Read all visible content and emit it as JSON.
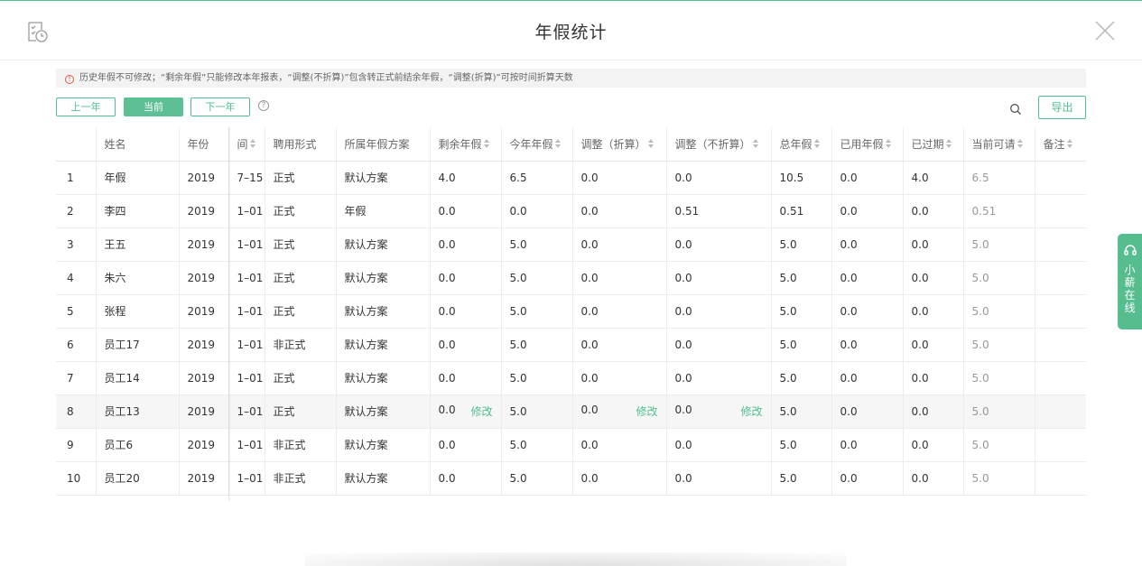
{
  "dialog": {
    "title": "年假统计"
  },
  "notice": "历史年假不可修改；“剩余年假”只能修改本年报表，“调整(不折算)”包含转正式前结余年假，“调整(折算)”可按时间折算天数",
  "toolbar": {
    "prev_year": "上一年",
    "current": "当前",
    "next_year": "下一年",
    "help": "?",
    "export": "导出"
  },
  "table": {
    "columns": [
      "",
      "姓名",
      "年份",
      "间",
      "聘用形式",
      "所属年假方案",
      "剩余年假",
      "今年年假",
      "调整（折算）",
      "调整（不折算）",
      "总年假",
      "已用年假",
      "已过期",
      "当前可请",
      "备注"
    ],
    "edit_label": "修改",
    "rows": [
      [
        "1",
        "年假",
        "2019",
        "7–15",
        "正式",
        "默认方案",
        "4.0",
        "6.5",
        "0.0",
        "0.0",
        "10.5",
        "0.0",
        "4.0",
        "6.5",
        ""
      ],
      [
        "2",
        "李四",
        "2019",
        "1–01",
        "正式",
        "年假",
        "0.0",
        "0.0",
        "0.0",
        "0.51",
        "0.51",
        "0.0",
        "0.0",
        "0.51",
        ""
      ],
      [
        "3",
        "王五",
        "2019",
        "1–01",
        "正式",
        "默认方案",
        "0.0",
        "5.0",
        "0.0",
        "0.0",
        "5.0",
        "0.0",
        "0.0",
        "5.0",
        ""
      ],
      [
        "4",
        "朱六",
        "2019",
        "1–01",
        "正式",
        "默认方案",
        "0.0",
        "5.0",
        "0.0",
        "0.0",
        "5.0",
        "0.0",
        "0.0",
        "5.0",
        ""
      ],
      [
        "5",
        "张程",
        "2019",
        "1–01",
        "正式",
        "默认方案",
        "0.0",
        "5.0",
        "0.0",
        "0.0",
        "5.0",
        "0.0",
        "0.0",
        "5.0",
        ""
      ],
      [
        "6",
        "员工17",
        "2019",
        "1–01",
        "非正式",
        "默认方案",
        "0.0",
        "5.0",
        "0.0",
        "0.0",
        "5.0",
        "0.0",
        "0.0",
        "5.0",
        ""
      ],
      [
        "7",
        "员工14",
        "2019",
        "1–01",
        "正式",
        "默认方案",
        "0.0",
        "5.0",
        "0.0",
        "0.0",
        "5.0",
        "0.0",
        "0.0",
        "5.0",
        ""
      ],
      [
        "8",
        "员工13",
        "2019",
        "1–01",
        "正式",
        "默认方案",
        "0.0",
        "5.0",
        "0.0",
        "0.0",
        "5.0",
        "0.0",
        "0.0",
        "5.0",
        ""
      ],
      [
        "9",
        "员工6",
        "2019",
        "1–01",
        "非正式",
        "默认方案",
        "0.0",
        "5.0",
        "0.0",
        "0.0",
        "5.0",
        "0.0",
        "0.0",
        "5.0",
        ""
      ],
      [
        "10",
        "员工20",
        "2019",
        "1–01",
        "非正式",
        "默认方案",
        "0.0",
        "5.0",
        "0.0",
        "0.0",
        "5.0",
        "0.0",
        "0.0",
        "5.0",
        ""
      ]
    ]
  },
  "chat": {
    "label": "小薪在线"
  },
  "colors": {
    "accent": "#4fbf8f",
    "warning": "#e25a4a"
  }
}
